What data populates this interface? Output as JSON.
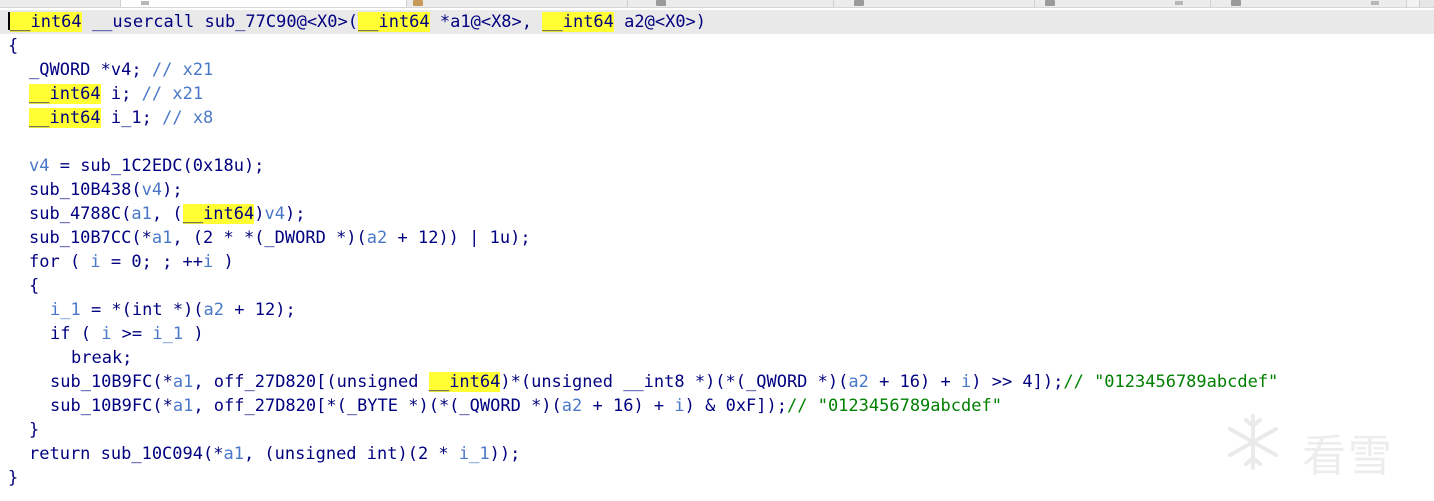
{
  "code": {
    "header": {
      "ret_type": "__int64",
      "mid": " __usercall sub_77C90@<X0>(",
      "arg1_type": "__int64",
      "arg1_rest": " *a1@<X8>, ",
      "arg2_type": "__int64",
      "arg2_rest": " a2@<X0>)"
    },
    "open_brace": "{",
    "decl1": {
      "type": "_QWORD ",
      "star": "*",
      "var": "v4",
      "semi": "; ",
      "comment": "// x21"
    },
    "decl2": {
      "type": "__int64",
      "rest_pre": " ",
      "var": "i",
      "semi": "; ",
      "comment": "// x21"
    },
    "decl3": {
      "type": "__int64",
      "rest_pre": " ",
      "var": "i_1",
      "semi": "; ",
      "comment": "// x8"
    },
    "s1": {
      "var": "v4",
      "rest": " = sub_1C2EDC(0x18u);"
    },
    "s2": {
      "pre": "sub_10B438(",
      "var": "v4",
      "post": ");"
    },
    "s3": {
      "pre": "sub_4788C(",
      "a1": "a1",
      "mid": ", (",
      "type": "__int64",
      "close": ")",
      "var": "v4",
      "post": ");"
    },
    "s4": {
      "pre": "sub_10B7CC(*",
      "a1": "a1",
      "mid": ", (2 * *(_DWORD *)(",
      "a2": "a2",
      "post": " + 12)) | 1u);"
    },
    "s5": {
      "pre": "for ( ",
      "i1": "i",
      "mid": " = 0; ; ++",
      "i2": "i",
      "post": " )"
    },
    "open_brace2": "{",
    "s6": {
      "var": "i_1",
      "mid": " = *(int *)(",
      "a2": "a2",
      "post": " + 12);"
    },
    "s7": {
      "pre": "if ( ",
      "i": "i",
      "mid": " >= ",
      "i_1": "i_1",
      "post": " )"
    },
    "s8": "break;",
    "s9": {
      "pre": "sub_10B9FC(*",
      "a1": "a1",
      "mid1": ", off_27D820[(unsigned ",
      "type": "__int64",
      "mid2": ")*(unsigned __int8 *)(*(_QWORD *)(",
      "a2": "a2",
      "mid3": " + 16) + ",
      "i": "i",
      "post": ") >> 4]);",
      "comment": "// \"0123456789abcdef\""
    },
    "s10": {
      "pre": "sub_10B9FC(*",
      "a1": "a1",
      "mid1": ", off_27D820[*(_BYTE *)(*(_QWORD *)(",
      "a2": "a2",
      "mid2": " + 16) + ",
      "i": "i",
      "post": ") & 0xF]);",
      "comment": "// \"0123456789abcdef\""
    },
    "close_brace2": "}",
    "s11": {
      "pre": "return sub_10C094(*",
      "a1": "a1",
      "mid": ", (unsigned int)(2 * ",
      "i_1": "i_1",
      "post": "));"
    },
    "close_brace": "}"
  },
  "watermark": {
    "logo_icon": "snowflake-icon",
    "text": "看雪"
  },
  "colors": {
    "highlight": "#ffff33",
    "variable": "#4a78c8",
    "string": "#008000",
    "text": "#000080"
  }
}
